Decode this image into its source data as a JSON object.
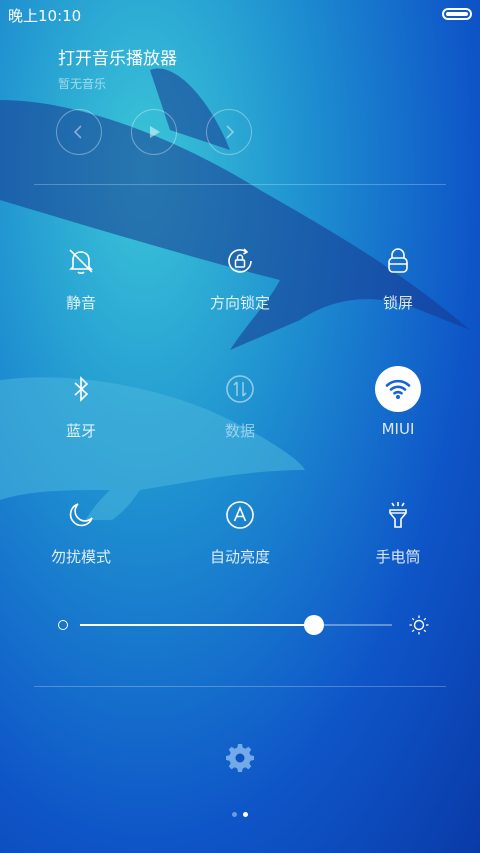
{
  "status": {
    "time": "晚上10:10"
  },
  "music": {
    "title": "打开音乐播放器",
    "subtitle": "暂无音乐"
  },
  "toggles": [
    {
      "label": "静音",
      "icon": "bell-off-icon",
      "state": "on"
    },
    {
      "label": "方向锁定",
      "icon": "rotation-lock-icon",
      "state": "on"
    },
    {
      "label": "锁屏",
      "icon": "lock-icon",
      "state": "on"
    },
    {
      "label": "蓝牙",
      "icon": "bluetooth-icon",
      "state": "on"
    },
    {
      "label": "数据",
      "icon": "mobile-data-icon",
      "state": "off"
    },
    {
      "label": "MIUI",
      "icon": "wifi-icon",
      "state": "active"
    },
    {
      "label": "勿扰模式",
      "icon": "moon-icon",
      "state": "on"
    },
    {
      "label": "自动亮度",
      "icon": "auto-brightness-icon",
      "state": "on"
    },
    {
      "label": "手电筒",
      "icon": "flashlight-icon",
      "state": "on"
    }
  ],
  "brightness": {
    "level_percent": 75
  },
  "pagination": {
    "pages": 2,
    "current": 2
  },
  "colors": {
    "active_toggle_bg": "#ffffff",
    "active_icon": "#1565d8"
  }
}
